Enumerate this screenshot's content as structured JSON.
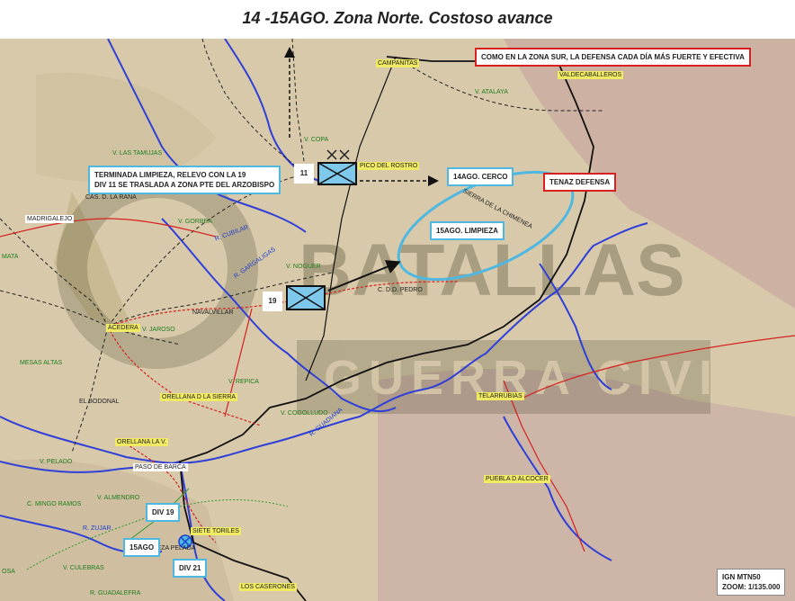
{
  "title": "14 -15AGO. Zona Norte. Costoso avance",
  "callouts": {
    "south_zone": "COMO EN LA ZONA SUR, LA DEFENSA CADA DÍA MÁS FUERTE Y EFECTIVA",
    "relief_line1": "TERMINADA LIMPIEZA, RELEVO CON LA 19",
    "relief_line2": "DIV 11 SE TRASLADA A ZONA PTE DEL ARZOBISPO",
    "cerco": "14AGO. CERCO",
    "limpieza": "15AGO. LIMPIEZA",
    "tenaz": "TENAZ DEFENSA",
    "div19": "DIV 19",
    "aug15": "15AGO",
    "div21": "DIV 21",
    "ign_line1": "IGN MTN50",
    "ign_line2": "ZOOM: 1/135.000"
  },
  "units": {
    "unit11": "11",
    "unit19": "19"
  },
  "watermark": {
    "line1": "BATALLAS",
    "line2": "GUERRA CIVIL"
  },
  "places": {
    "campanitas": "CAMPANITAS",
    "valdecaballeros": "VALDECABALLEROS",
    "atalaya": "V. ATALAYA",
    "copa": "V. COPA",
    "pico_rostro": "PICO DEL ROSTRO",
    "tamujo": "V. LAS TAMUJAS",
    "casa_rana": "CAS. D. LA RANA",
    "madrigalejo": "MADRIGALEJO",
    "gorbea": "V. GORBEA",
    "cubilar": "R. CUBILAR",
    "sierra_chimenea": "SIERRA DE LA CHIMENEA",
    "mata": "MATA",
    "gargaligas": "R. GARGALIGAS",
    "noguer": "V. NOGUER",
    "cdd_pedro": "C. D.D. PEDRO",
    "navalvillar": "NAVALVILLAR",
    "acedera": "ACEDERA",
    "jaroso": "V. JAROSO",
    "mesas_altas": "MESAS ALTAS",
    "repica": "V. REPICA",
    "orellana_sierra": "ORELLANA D LA SIERRA",
    "bodonal": "EL BODONAL",
    "cogolludo": "V. COGOLLUDO",
    "guadiana": "R. GUADIANA",
    "telarrubias": "TELARRUBIAS",
    "orellana_vieja": "ORELLANA LA V.",
    "pelado": "V. PELADO",
    "paso_barca": "PASO DE BARCA",
    "almendro": "V. ALMENDRO",
    "mingo_ramos": "C. MINGO RAMOS",
    "siete_toriles": "SIETE TORILES",
    "cabeza_pelada": "LA CABEZA PELADA",
    "puebla_alcocer": "PUEBLA D ALCOCER",
    "culebras": "V. CULEBRAS",
    "guadalefra": "R. GUADALEFRA",
    "caserones": "LOS CASERONES",
    "zujar": "R. ZUJAR",
    "osa": "OSA"
  }
}
